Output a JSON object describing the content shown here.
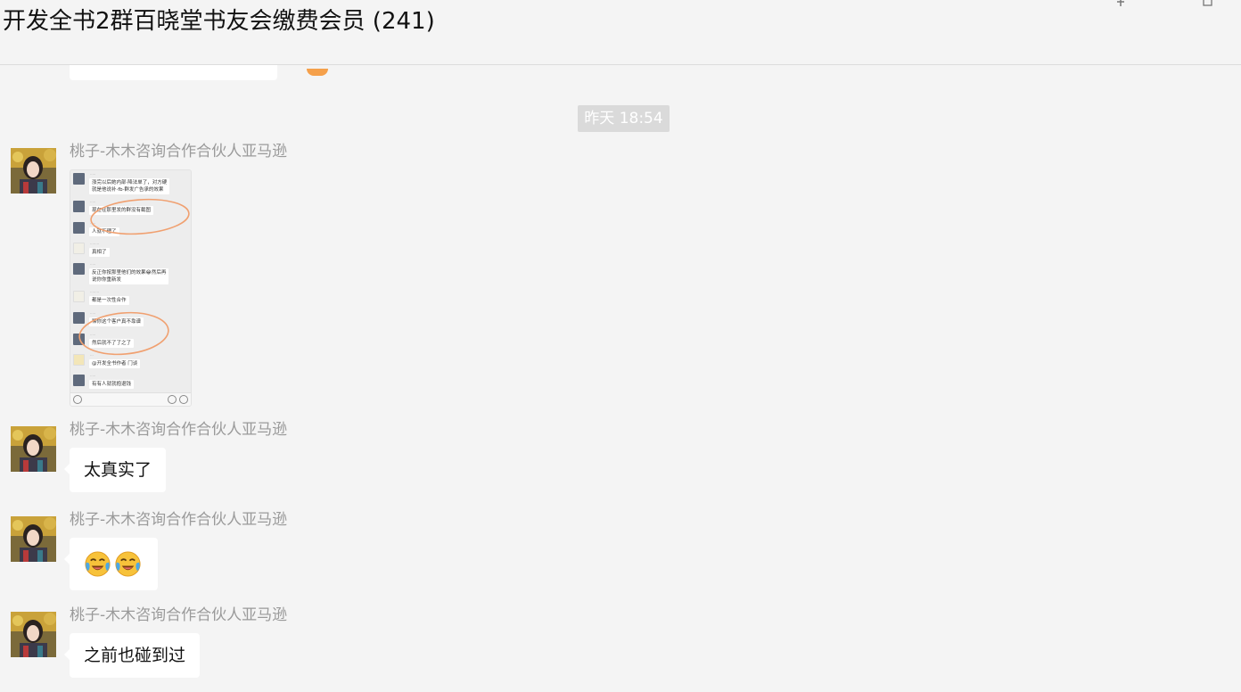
{
  "window": {
    "title": "开发全书2群百晓堂书友会缴费会员 (241)"
  },
  "chat": {
    "timestamp": "昨天 18:54",
    "messages": [
      {
        "sender": "桃子-木木咨询合作合伙人亚马逊",
        "type": "image",
        "screenshot": {
          "lines": [
            {
              "name": "",
              "text": "涨完以后她内部·降法单了，对方硬",
              "text2": "就是他说补·fb·群发广告承的效果",
              "avatar": "dark"
            },
            {
              "name": "",
              "text": "现在在那里发的群没有截图",
              "avatar": "dark"
            },
            {
              "name": "",
              "text": "人就不理了",
              "avatar": "dark"
            },
            {
              "name": "",
              "text": "真相了",
              "avatar": "light"
            },
            {
              "name": "",
              "text": "反正你按那里他们的效果😂然后再",
              "text2": "说你你重新发",
              "avatar": "dark"
            },
            {
              "name": "",
              "text": "都是一次性合作",
              "avatar": "light"
            },
            {
              "name": "",
              "text": "稀你这个客户真不靠谱",
              "avatar": "dark"
            },
            {
              "name": "",
              "text": "然后就不了了之了",
              "avatar": "dark"
            },
            {
              "name": "",
              "text": "@开发全书作者  门谈",
              "avatar": "light"
            },
            {
              "name": "",
              "text": "有有人就就抱退钱",
              "avatar": "dark"
            }
          ]
        }
      },
      {
        "sender": "桃子-木木咨询合作合伙人亚马逊",
        "type": "text",
        "text": "太真实了"
      },
      {
        "sender": "桃子-木木咨询合作合伙人亚马逊",
        "type": "emoji",
        "emojis": [
          "crying-laughing-emoji",
          "crying-laughing-emoji"
        ]
      },
      {
        "sender": "桃子-木木咨询合作合伙人亚马逊",
        "type": "text",
        "text": "之前也碰到过"
      }
    ]
  }
}
